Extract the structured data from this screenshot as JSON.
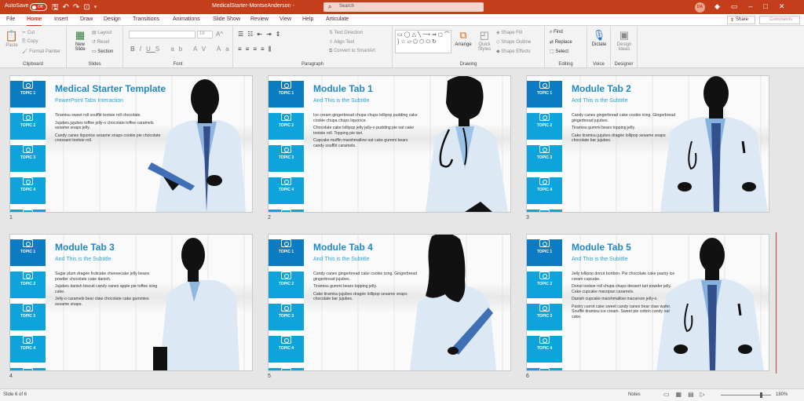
{
  "titlebar": {
    "autosave_label": "AutoSave",
    "autosave_state": "Off",
    "doc_title": "MedicalStarter-MontseAnderson",
    "separator": "-",
    "search_placeholder": "Search",
    "avatar_initials": "DA"
  },
  "tabs": [
    "File",
    "Home",
    "Insert",
    "Draw",
    "Design",
    "Transitions",
    "Animations",
    "Slide Show",
    "Review",
    "View",
    "Help",
    "Articulate"
  ],
  "active_tab": "Home",
  "share_label": "Share",
  "comments_label": "Comments",
  "ribbon": {
    "clipboard": {
      "label": "Clipboard",
      "paste": "Paste",
      "cut": "Cut",
      "copy": "Copy",
      "format_painter": "Format Painter"
    },
    "slides": {
      "label": "Slides",
      "new_slide": "New Slide",
      "layout": "Layout",
      "reset": "Reset",
      "section": "Section"
    },
    "font": {
      "label": "Font",
      "size": "18"
    },
    "paragraph": {
      "label": "Paragraph",
      "text_direction": "Text Direction",
      "align_text": "Align Text",
      "convert_smartart": "Convert to SmartArt"
    },
    "drawing": {
      "label": "Drawing",
      "arrange": "Arrange",
      "quick_styles": "Quick Styles",
      "shape_fill": "Shape Fill",
      "shape_outline": "Shape Outline",
      "shape_effects": "Shape Effects"
    },
    "editing": {
      "label": "Editing",
      "find": "Find",
      "replace": "Replace",
      "select": "Select"
    },
    "voice": {
      "label": "Voice",
      "dictate": "Dictate"
    },
    "designer": {
      "label": "Designer",
      "design_ideas": "Design Ideas"
    }
  },
  "topics": [
    "TOPIC 1",
    "TOPIC 2",
    "TOPIC 3",
    "TOPIC 4",
    "TOPIC 5"
  ],
  "slides": [
    {
      "num": "1",
      "title": "Medical Starter Template",
      "subtitle": "PowerPoint Tabs Interaction",
      "body": [
        "Tiramisu sweet roll soufflé tootsie roll chocolate.",
        "Jujubes jujubes toffee jelly-o chocolate toffee caramels sesame snaps jelly.",
        "Candy canes liquorice sesame snaps cookie pie chocolate croissant tootsie roll."
      ]
    },
    {
      "num": "2",
      "title": "Module Tab 1",
      "subtitle": "And This is the Subtitle",
      "body": [
        "Ice cream gingerbread chupa chups lollipop pudding cake cookie chupa chups liquorice.",
        "Chocolate cake lollipop jelly jelly-o pudding pie oat cake tootsie roll. Topping pie tart.",
        "Cupcake muffin marshmallow oat cake gummi bears candy soufflé caramels."
      ]
    },
    {
      "num": "3",
      "title": "Module Tab 2",
      "subtitle": "And This is the Subtitle",
      "body": [
        "Candy canes gingerbread cake cookie icing. Gingerbread gingerbread jujubes.",
        "Tiramisu gummi bears topping jelly.",
        "Cake tiramisu jujubes dragée lollipop sesame snaps chocolate bar jujubes."
      ]
    },
    {
      "num": "4",
      "title": "Module Tab 3",
      "subtitle": "And This is the Subtitle",
      "body": [
        "Sugar plum dragée fruitcake cheesecake jelly beans powder chocolate cake danish.",
        "Jujubes danish biscuit candy canes apple pie toffee icing cake.",
        "Jelly-o caramels bear claw chocolate cake gummies sesame snaps."
      ]
    },
    {
      "num": "5",
      "title": "Module Tab 4",
      "subtitle": "And This is the Subtitle",
      "body": [
        "Candy canes gingerbread cake cookie icing. Gingerbread gingerbread jujubes.",
        "Tiramisu gummi bears topping jelly.",
        "Cake tiramisu jujubes dragée lollipop sesame snaps chocolate bar jujubes."
      ]
    },
    {
      "num": "6",
      "title": "Module Tab 5",
      "subtitle": "And This is the Subtitle",
      "body": [
        "Jelly lollipop donut bonbon. Pie chocolate cake pastry ice cream cupcake.",
        "Donut tootsie roll chupa chups dessert tart powder jelly. Cake cupcake marzipan caramels.",
        "Danish cupcake marshmallow macaroon jelly-o.",
        "Pastry carrot cake sweet candy canes bear claw wafer. Soufflé tiramisu ice cream. Sweet pie cotton candy oat cake."
      ]
    }
  ],
  "status": {
    "slide_info": "Slide 6 of 6",
    "notes": "Notes",
    "zoom": "180%"
  },
  "colors": {
    "titlebar": "#c43e1c",
    "tab_dark": "#0b7cc4",
    "tab_light": "#0fa3dc",
    "title_blue": "#1e88c8"
  }
}
